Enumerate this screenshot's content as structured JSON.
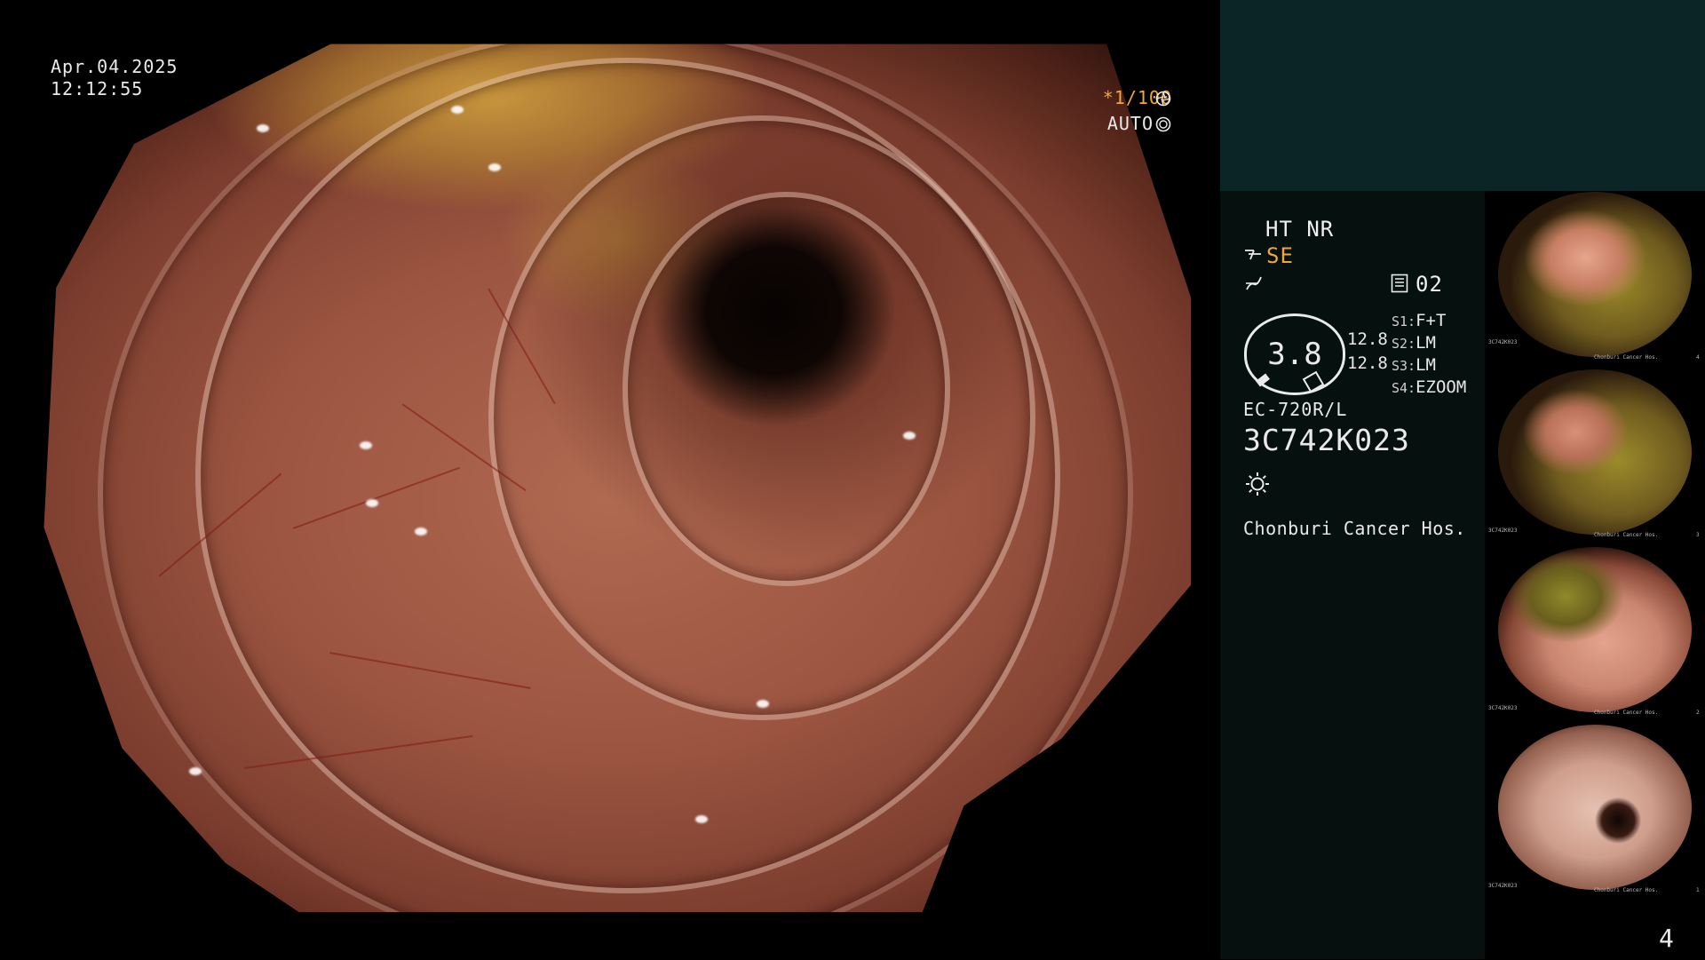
{
  "view": {
    "date": "Apr.04.2025",
    "time": "12:12:55",
    "shutter": "*1/100",
    "iris": "AUTO"
  },
  "panel": {
    "mode_line": "HT NR",
    "enhancement": "SE",
    "memory_channel": "02",
    "gauge_value": "3.8",
    "gauge_right_1": "12.8",
    "gauge_right_2": "12.8",
    "presets": [
      {
        "key": "S1:",
        "value": "F+T"
      },
      {
        "key": "S2:",
        "value": "LM"
      },
      {
        "key": "S3:",
        "value": "LM"
      },
      {
        "key": "S4:",
        "value": "EZOOM"
      }
    ],
    "scope_model": "EC-720R/L",
    "serial": "3C742K023",
    "hospital": "Chonburi Cancer Hos."
  },
  "thumbnails": [
    {
      "serial": "3C742K023",
      "hospital": "Chonburi Cancer Hos.",
      "index": "4"
    },
    {
      "serial": "3C742K023",
      "hospital": "Chonburi Cancer Hos.",
      "index": "3"
    },
    {
      "serial": "3C742K023",
      "hospital": "Chonburi Cancer Hos.",
      "index": "2"
    },
    {
      "serial": "3C742K023",
      "hospital": "Chonburi Cancer Hos.",
      "index": "1"
    }
  ],
  "page_number": "4",
  "colors": {
    "accent": "#f0a63a",
    "panel_top": "#0b2426",
    "panel": "#06110f"
  },
  "icons": {
    "shutter": "shutter-icon",
    "iris": "iris-icon",
    "enhance": "enhance-icon",
    "freeze": "freeze-icon",
    "memory": "memory-icon",
    "light": "light-icon"
  }
}
